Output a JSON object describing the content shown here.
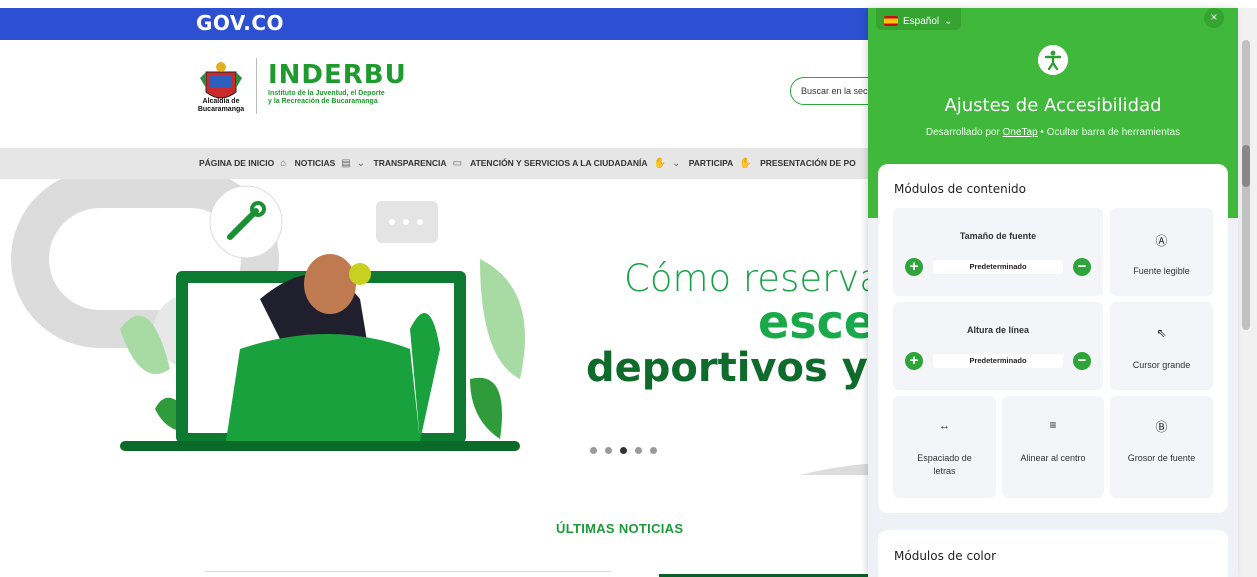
{
  "gov": {
    "logo": "GOV.CO"
  },
  "header": {
    "crest_caption": "Alcaldía de Bucaramanga",
    "brand": "INDERBU",
    "brand_sub_1": "Instituto de la Juventud, el Deporte",
    "brand_sub_2": "y la Recreación de Bucaramanga",
    "search_placeholder": "Buscar en la sec"
  },
  "nav": {
    "items": [
      {
        "label": "PÁGINA DE INICIO",
        "icon": "home-icon",
        "glyph": "⌂"
      },
      {
        "label": "NOTICIAS",
        "icon": "news-icon",
        "glyph": "▤"
      },
      {
        "label": "TRANSPARENCIA",
        "icon": "monitor-icon",
        "glyph": "▭"
      },
      {
        "label": "ATENCIÓN Y SERVICIOS A LA CIUDADANÍA",
        "icon": "handshake-icon",
        "glyph": "✋"
      },
      {
        "label": "PARTICIPA",
        "icon": "hand-icon",
        "glyph": "✋"
      },
      {
        "label": "PRESENTACIÓN DE PO",
        "icon": "",
        "glyph": ""
      }
    ]
  },
  "hero": {
    "line1": "Cómo reservar",
    "line2": "esce",
    "line3": "deportivos y r",
    "slides": 5,
    "active_slide": 3
  },
  "news": {
    "title": "ÚLTIMAS NOTICIAS"
  },
  "panel": {
    "language": "Español",
    "close": "×",
    "title": "Ajustes de Accesibilidad",
    "sub_prefix": "Desarrollado por ",
    "sub_link": "OneTap",
    "sub_suffix": " • Ocultar barra de herramientas",
    "content_title": "Módulos de contenido",
    "font_size_label": "Tamaño de fuente",
    "font_size_value": "Predeterminado",
    "line_height_label": "Altura de línea",
    "line_height_value": "Predeterminado",
    "readable_font": "Fuente legible",
    "big_cursor": "Cursor grande",
    "letter_spacing": "Espaciado de letras",
    "align_center": "Alinear al centro",
    "font_weight": "Grosor de fuente",
    "color_title": "Módulos de color"
  },
  "colors": {
    "gov_blue": "#2d4fd1",
    "brand_green": "#1e9b2e",
    "panel_green": "#3fb83b"
  }
}
